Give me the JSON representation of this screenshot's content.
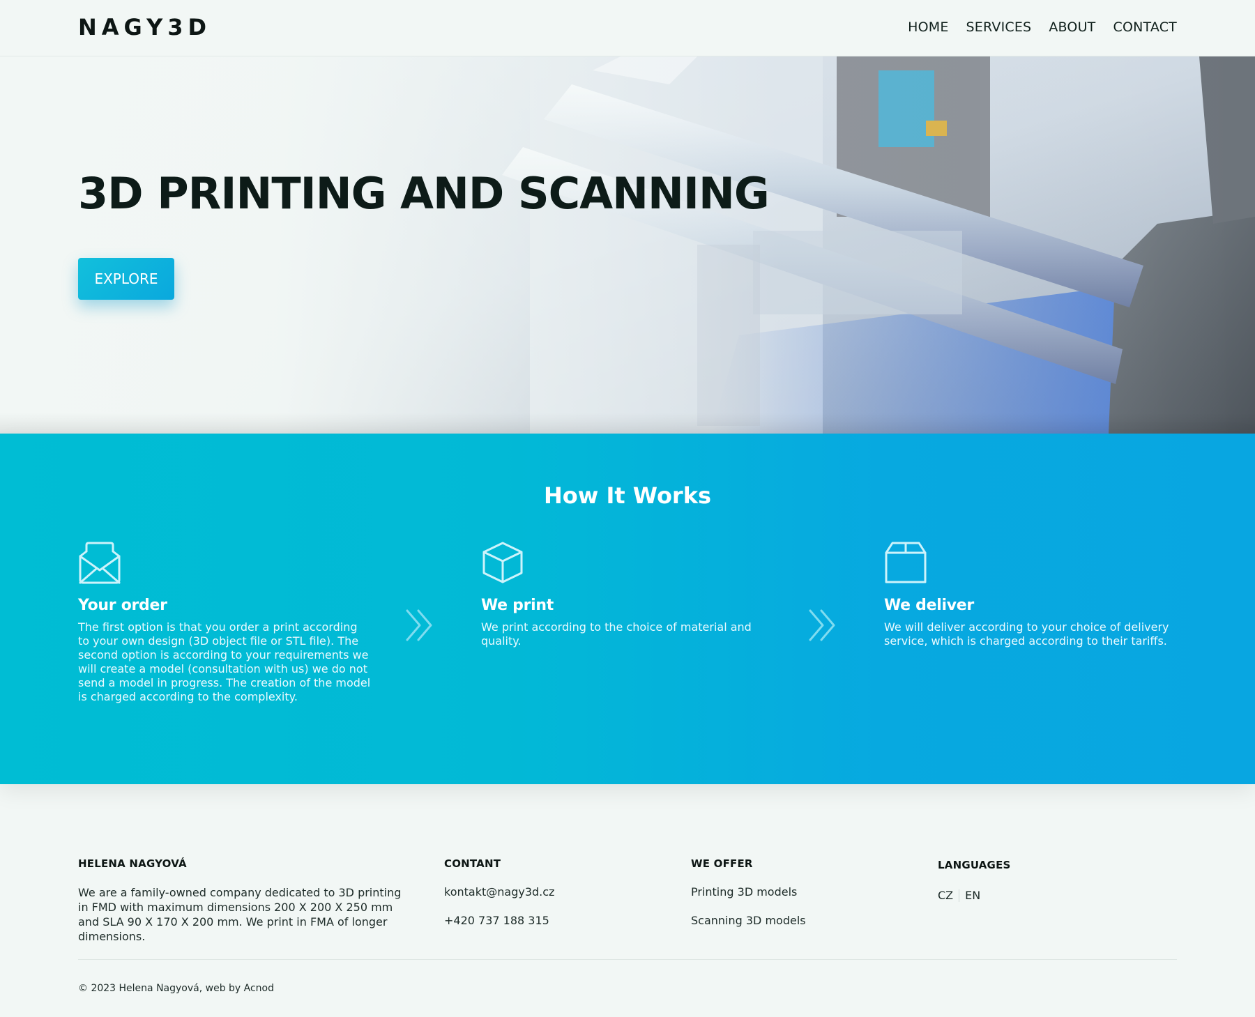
{
  "header": {
    "logo": "NAGY3D",
    "nav": [
      "HOME",
      "SERVICES",
      "ABOUT",
      "CONTACT"
    ]
  },
  "hero": {
    "title": "3D PRINTING AND SCANNING",
    "button_label": "EXPLORE"
  },
  "how_it_works": {
    "title": "How It Works",
    "steps": [
      {
        "icon": "envelope-open-icon",
        "title": "Your order",
        "text": "The first option is that you order a print according to your own design (3D object file or STL file). The second option is according to your requirements we will create a model (consultation with us) we do not send a model in progress. The creation of the model is charged according to the complexity."
      },
      {
        "icon": "cube-icon",
        "title": "We print",
        "text": "We print according to the choice of material and quality."
      },
      {
        "icon": "box-icon",
        "title": "We deliver",
        "text": "We will deliver according to your choice of delivery service, which is charged according to their tariffs."
      }
    ]
  },
  "footer": {
    "about": {
      "heading": "HELENA NAGYOVÁ",
      "text": "We are a family-owned company dedicated to 3D printing in FMD with maximum dimensions 200 X 200 X 250 mm and SLA 90 X 170 X 200 mm. We print in FMA of longer dimensions."
    },
    "contact": {
      "heading": "CONTANT",
      "email": "kontakt@nagy3d.cz",
      "phone": "+420 737 188 315"
    },
    "offer": {
      "heading": "WE OFFER",
      "items": [
        "Printing 3D models",
        "Scanning 3D models"
      ]
    },
    "languages": {
      "heading": "LANGUAGES",
      "items": [
        "CZ",
        "EN"
      ]
    },
    "copyright": "© 2023 Helena Nagyová, web by Acnod"
  },
  "colors": {
    "accent": "#08b4dc",
    "background": "#f2f7f5",
    "text_dark": "#0d1b18"
  }
}
